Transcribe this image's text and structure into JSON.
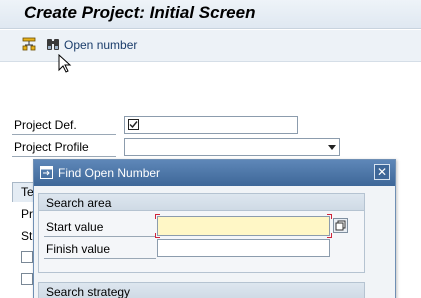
{
  "window": {
    "title": "Create Project: Initial Screen"
  },
  "toolbar": {
    "icons": [
      "hierarchy-icon",
      "binoculars-icon"
    ],
    "open_number_label": "Open number"
  },
  "form": {
    "project_def_label": "Project Def.",
    "project_def_value": "",
    "project_profile_label": "Project Profile",
    "project_profile_value": ""
  },
  "background": {
    "tab_fragment": "Te",
    "row_fragment_1": "Pr",
    "row_fragment_2": "St"
  },
  "dialog": {
    "title": "Find Open Number",
    "close_glyph": "✕",
    "search_area_title": "Search area",
    "start_value_label": "Start value",
    "start_value": "",
    "finish_value_label": "Finish value",
    "finish_value": "",
    "search_strategy_title": "Search strategy"
  },
  "colors": {
    "dialog_title_bg": "#3e6798",
    "focused_input_bg": "#fff7c6",
    "focus_marker": "#d0243a",
    "link_text": "#1b3d6b"
  }
}
